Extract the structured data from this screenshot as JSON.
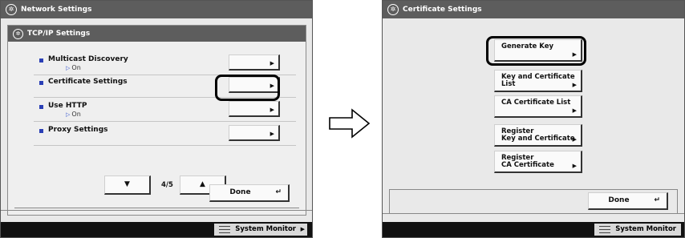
{
  "left": {
    "window_title": "Network Settings",
    "panel_title": "TCP/IP Settings",
    "rows": [
      {
        "label": "Multicast Discovery",
        "value": "On"
      },
      {
        "label": "Certificate Settings",
        "value": ""
      },
      {
        "label": "Use HTTP",
        "value": "On"
      },
      {
        "label": "Proxy Settings",
        "value": ""
      }
    ],
    "page_indicator": "4/5",
    "done_label": "Done",
    "system_monitor": "System Monitor"
  },
  "right": {
    "window_title": "Certificate Settings",
    "buttons": [
      {
        "line1": "Generate Key",
        "line2": ""
      },
      {
        "line1": "Key and Certificate",
        "line2": "List"
      },
      {
        "line1": "CA Certificate List",
        "line2": ""
      },
      {
        "line1": "Register",
        "line2": "Key and Certificate"
      },
      {
        "line1": "Register",
        "line2": "CA Certificate"
      }
    ],
    "done_label": "Done",
    "system_monitor": "System Monitor"
  },
  "icons": {
    "title_icon": "network-settings-icon",
    "row_arrow": "play-icon",
    "nav_down": "triangle-down-icon",
    "nav_up": "triangle-up-icon",
    "return": "return-icon",
    "transition": "hollow-right-arrow-icon"
  },
  "colors": {
    "title_bar": "#5d5d5d",
    "bullet": "#2a3fb5",
    "highlight": "#000000"
  }
}
